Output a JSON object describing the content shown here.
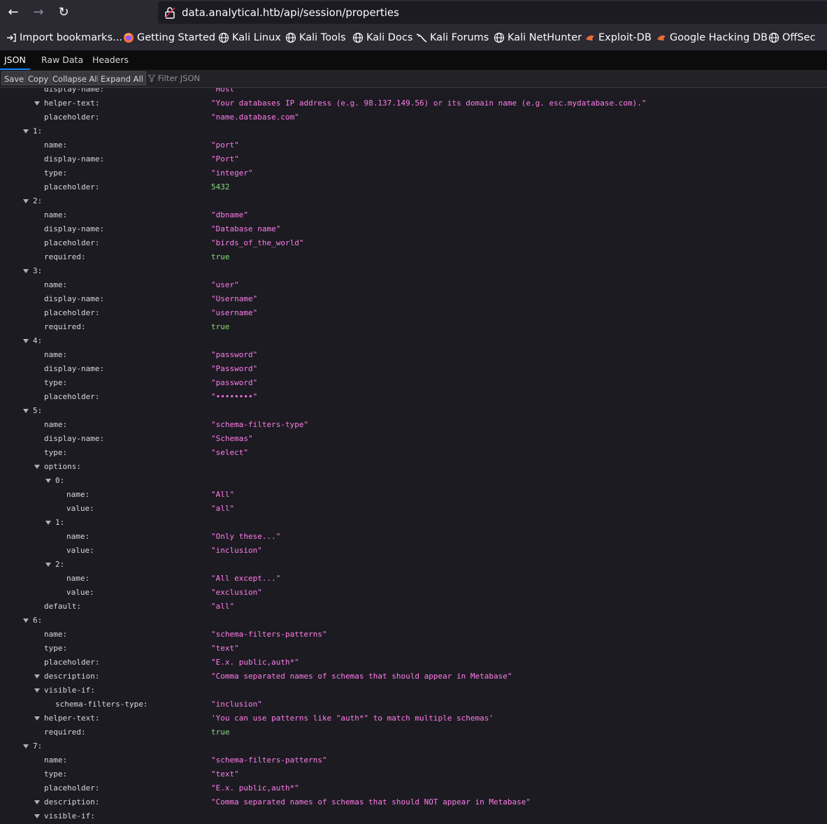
{
  "browser": {
    "url": "data.analytical.htb/api/session/properties",
    "bookmarks": [
      {
        "label": "Import bookmarks...",
        "icon": "import-icon"
      },
      {
        "label": "Getting Started",
        "icon": "firefox-icon"
      },
      {
        "label": "Kali Linux",
        "icon": "globe-icon"
      },
      {
        "label": "Kali Tools",
        "icon": "globe-icon"
      },
      {
        "label": "Kali Docs",
        "icon": "globe-icon"
      },
      {
        "label": "Kali Forums",
        "icon": "kali-dragon-icon"
      },
      {
        "label": "Kali NetHunter",
        "icon": "globe-icon"
      },
      {
        "label": "Exploit-DB",
        "icon": "exploitdb-icon"
      },
      {
        "label": "Google Hacking DB",
        "icon": "exploitdb-icon"
      },
      {
        "label": "OffSec",
        "icon": "globe-icon"
      }
    ]
  },
  "viewer": {
    "tabs": [
      "JSON",
      "Raw Data",
      "Headers"
    ],
    "active_tab": "JSON",
    "toolbar": {
      "save": "Save",
      "copy": "Copy",
      "collapse": "Collapse All",
      "expand": "Expand All",
      "filter_placeholder": "Filter JSON"
    }
  },
  "colors": {
    "string": "#ff7de9",
    "number": "#86de74",
    "key": "#d7d7db",
    "background": "#1c1b22"
  },
  "json_rows": [
    {
      "depth": 2,
      "key": "display-name",
      "value": "\"Host\"",
      "type": "string"
    },
    {
      "depth": 2,
      "key": "helper-text",
      "value": "\"Your databases IP address (e.g. 98.137.149.56) or its domain name (e.g. esc.mydatabase.com).\"",
      "type": "string",
      "toggle": true
    },
    {
      "depth": 2,
      "key": "placeholder",
      "value": "\"name.database.com\"",
      "type": "string"
    },
    {
      "depth": 1,
      "key": "1",
      "value": "",
      "toggle": true
    },
    {
      "depth": 2,
      "key": "name",
      "value": "\"port\"",
      "type": "string"
    },
    {
      "depth": 2,
      "key": "display-name",
      "value": "\"Port\"",
      "type": "string"
    },
    {
      "depth": 2,
      "key": "type",
      "value": "\"integer\"",
      "type": "string"
    },
    {
      "depth": 2,
      "key": "placeholder",
      "value": "5432",
      "type": "number"
    },
    {
      "depth": 1,
      "key": "2",
      "value": "",
      "toggle": true
    },
    {
      "depth": 2,
      "key": "name",
      "value": "\"dbname\"",
      "type": "string"
    },
    {
      "depth": 2,
      "key": "display-name",
      "value": "\"Database name\"",
      "type": "string"
    },
    {
      "depth": 2,
      "key": "placeholder",
      "value": "\"birds_of_the_world\"",
      "type": "string"
    },
    {
      "depth": 2,
      "key": "required",
      "value": "true",
      "type": "bool"
    },
    {
      "depth": 1,
      "key": "3",
      "value": "",
      "toggle": true
    },
    {
      "depth": 2,
      "key": "name",
      "value": "\"user\"",
      "type": "string"
    },
    {
      "depth": 2,
      "key": "display-name",
      "value": "\"Username\"",
      "type": "string"
    },
    {
      "depth": 2,
      "key": "placeholder",
      "value": "\"username\"",
      "type": "string"
    },
    {
      "depth": 2,
      "key": "required",
      "value": "true",
      "type": "bool"
    },
    {
      "depth": 1,
      "key": "4",
      "value": "",
      "toggle": true
    },
    {
      "depth": 2,
      "key": "name",
      "value": "\"password\"",
      "type": "string"
    },
    {
      "depth": 2,
      "key": "display-name",
      "value": "\"Password\"",
      "type": "string"
    },
    {
      "depth": 2,
      "key": "type",
      "value": "\"password\"",
      "type": "string"
    },
    {
      "depth": 2,
      "key": "placeholder",
      "value": "\"••••••••\"",
      "type": "string"
    },
    {
      "depth": 1,
      "key": "5",
      "value": "",
      "toggle": true
    },
    {
      "depth": 2,
      "key": "name",
      "value": "\"schema-filters-type\"",
      "type": "string"
    },
    {
      "depth": 2,
      "key": "display-name",
      "value": "\"Schemas\"",
      "type": "string"
    },
    {
      "depth": 2,
      "key": "type",
      "value": "\"select\"",
      "type": "string"
    },
    {
      "depth": 2,
      "key": "options",
      "value": "",
      "toggle": true
    },
    {
      "depth": 3,
      "key": "0",
      "value": "",
      "toggle": true
    },
    {
      "depth": 4,
      "key": "name",
      "value": "\"All\"",
      "type": "string"
    },
    {
      "depth": 4,
      "key": "value",
      "value": "\"all\"",
      "type": "string"
    },
    {
      "depth": 3,
      "key": "1",
      "value": "",
      "toggle": true
    },
    {
      "depth": 4,
      "key": "name",
      "value": "\"Only these...\"",
      "type": "string"
    },
    {
      "depth": 4,
      "key": "value",
      "value": "\"inclusion\"",
      "type": "string"
    },
    {
      "depth": 3,
      "key": "2",
      "value": "",
      "toggle": true
    },
    {
      "depth": 4,
      "key": "name",
      "value": "\"All except...\"",
      "type": "string"
    },
    {
      "depth": 4,
      "key": "value",
      "value": "\"exclusion\"",
      "type": "string"
    },
    {
      "depth": 2,
      "key": "default",
      "value": "\"all\"",
      "type": "string"
    },
    {
      "depth": 1,
      "key": "6",
      "value": "",
      "toggle": true
    },
    {
      "depth": 2,
      "key": "name",
      "value": "\"schema-filters-patterns\"",
      "type": "string"
    },
    {
      "depth": 2,
      "key": "type",
      "value": "\"text\"",
      "type": "string"
    },
    {
      "depth": 2,
      "key": "placeholder",
      "value": "\"E.x. public,auth*\"",
      "type": "string"
    },
    {
      "depth": 2,
      "key": "description",
      "value": "\"Comma separated names of schemas that should appear in Metabase\"",
      "type": "string",
      "toggle": true
    },
    {
      "depth": 2,
      "key": "visible-if",
      "value": "",
      "toggle": true
    },
    {
      "depth": 3,
      "key": "schema-filters-type",
      "value": "\"inclusion\"",
      "type": "string"
    },
    {
      "depth": 2,
      "key": "helper-text",
      "value": "'You can use patterns like \"auth*\" to match multiple schemas'",
      "type": "string",
      "toggle": true
    },
    {
      "depth": 2,
      "key": "required",
      "value": "true",
      "type": "bool"
    },
    {
      "depth": 1,
      "key": "7",
      "value": "",
      "toggle": true
    },
    {
      "depth": 2,
      "key": "name",
      "value": "\"schema-filters-patterns\"",
      "type": "string"
    },
    {
      "depth": 2,
      "key": "type",
      "value": "\"text\"",
      "type": "string"
    },
    {
      "depth": 2,
      "key": "placeholder",
      "value": "\"E.x. public,auth*\"",
      "type": "string"
    },
    {
      "depth": 2,
      "key": "description",
      "value": "\"Comma separated names of schemas that should NOT appear in Metabase\"",
      "type": "string",
      "toggle": true
    },
    {
      "depth": 2,
      "key": "visible-if",
      "value": "",
      "toggle": true
    }
  ]
}
